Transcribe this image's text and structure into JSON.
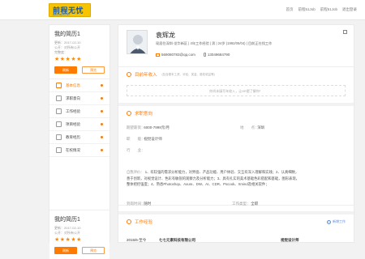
{
  "logo": {
    "main": "前程无忧",
    "sub": "www.51job.com"
  },
  "topnav": [
    "首页",
    "前程51Job",
    "前程51Job",
    "退出登录"
  ],
  "left": {
    "resume_title": "我的简历1",
    "updated": "更新：2017-02-10",
    "privacy": "公开：对所有公开",
    "completeness_label": "完整度：",
    "stars": "★★★★★",
    "refresh_btn": "刷新",
    "preview_btn": "预览",
    "nav": [
      {
        "label": "基本信息",
        "icon": "user-icon"
      },
      {
        "label": "求职意向",
        "icon": "target-icon"
      },
      {
        "label": "工作经验",
        "icon": "briefcase-icon"
      },
      {
        "label": "项目经验",
        "icon": "project-icon"
      },
      {
        "label": "教育经历",
        "icon": "education-icon"
      },
      {
        "label": "在校情况",
        "icon": "school-icon"
      }
    ],
    "card2": {
      "resume_title": "我的简历1",
      "updated": "更新：2017-02-10",
      "privacy": "公开：对所有公开",
      "stars": "★★★★★",
      "refresh_btn": "刷新",
      "preview_btn": "预览"
    }
  },
  "profile": {
    "name": "袁辉龙",
    "info": "现居住深圳-龙华新区 | 4年工作经验 | 男 | 24岁 (1992/05/04) | 目前正在找工作",
    "email": "569080783@qq.com",
    "phone": "13049684790"
  },
  "section_income": {
    "title": "目前年收入",
    "hint": "(包含基本工资、补贴、奖金、股权收益等)",
    "placeholder": "你尚未填写年收入，让HR更了解你！"
  },
  "section_intent": {
    "title": "求职意向",
    "salary_k": "期望薪资：",
    "salary_v": "6000-7999元/月",
    "location_k": "地　　点：",
    "location_v": "深圳",
    "function_k": "职　　能：",
    "function_v": "视觉设计师",
    "industry_k": "行　　业：",
    "industry_v": "",
    "eval_k": "自我评价：",
    "eval_v": "1、有较强的需求分析能力，对界面、产品功能、用户体验、交互有深入理解和实践；2、认真细致，善于创新，对视觉设计、色彩有敏锐的观察力及分析能力；3、具有扎实的美术基础色彩搭配和基础，图形表现，整体把控强度；4、熟悉Photoshop、Axure、DW、AI、CDR、Pscook、Xmind及相关软件；"
  },
  "section_arrival": {
    "time_k": "到岗时间：",
    "time_v": "随时",
    "type_k": "工作类型：",
    "type_v": "全职"
  },
  "section_work": {
    "title": "工作经验",
    "add_label": "新增工作",
    "period": "2015/6-至今",
    "company": "七七元素科技有限公司",
    "position": "视觉设计师"
  }
}
